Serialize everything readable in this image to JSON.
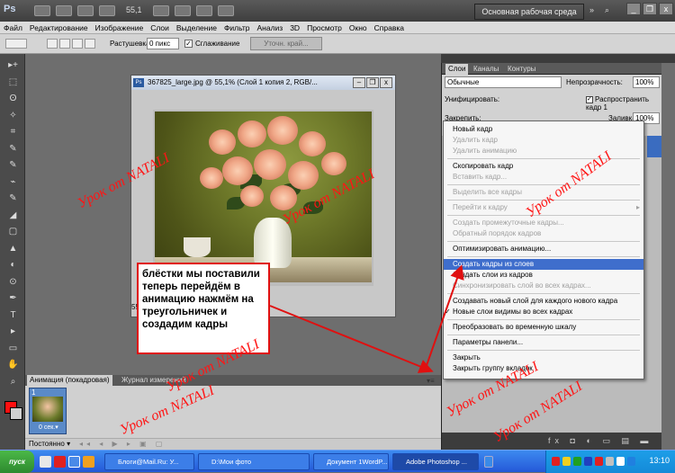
{
  "app": {
    "logo": "Ps",
    "zoom": "55,1",
    "workspace": "Основная рабочая среда",
    "workspace_arrow": "»",
    "search": "⌕",
    "minimize": "_",
    "restore": "❐",
    "close": "x"
  },
  "menubar": [
    "Файл",
    "Редактирование",
    "Изображение",
    "Слои",
    "Выделение",
    "Фильтр",
    "Анализ",
    "3D",
    "Просмотр",
    "Окно",
    "Справка"
  ],
  "options": {
    "feather_label": "Растушевка:",
    "feather_value": "0 пикс",
    "antialias_label": "Сглаживание",
    "antialias_checked": "✓",
    "refine_button": "Уточн. край..."
  },
  "document": {
    "title": "367825_large.jpg @ 55,1% (Слой 1 копия 2, RGB/...",
    "icon": "Ps",
    "minimize": "‒",
    "restore": "❐",
    "close": "x",
    "zoom_status": "55"
  },
  "note": "блёстки мы поставили теперь перейдём в анимацию нажмём на треугольничек и создадим кадры",
  "layers_panel": {
    "tabs": [
      "Слои",
      "Каналы",
      "Контуры"
    ],
    "blend_mode": "Обычные",
    "opacity_label": "Непрозрачность:",
    "opacity": "100%",
    "unify_label": "Унифицировать:",
    "propagate_label": "Распространить кадр 1",
    "propagate_checked": "✓",
    "lock_label": "Закрепить:",
    "fill_label": "Заливка:",
    "fill": "100%",
    "bottom_icons": "fx ◘ ◐ ▭ ▤ ▬"
  },
  "context_menu": {
    "items": [
      {
        "label": "Новый кадр",
        "state": "normal"
      },
      {
        "label": "Удалить кадр",
        "state": "disabled"
      },
      {
        "label": "Удалить анимацию",
        "state": "disabled"
      },
      {
        "sep": true
      },
      {
        "label": "Скопировать кадр",
        "state": "normal"
      },
      {
        "label": "Вставить кадр...",
        "state": "disabled"
      },
      {
        "sep": true
      },
      {
        "label": "Выделить все кадры",
        "state": "disabled"
      },
      {
        "sep": true
      },
      {
        "label": "Перейти к кадру",
        "state": "disabled",
        "submenu": true
      },
      {
        "sep": true
      },
      {
        "label": "Создать промежуточные кадры...",
        "state": "disabled"
      },
      {
        "label": "Обратный порядок кадров",
        "state": "disabled"
      },
      {
        "sep": true
      },
      {
        "label": "Оптимизировать анимацию...",
        "state": "normal"
      },
      {
        "sep": true
      },
      {
        "label": "Создать кадры из слоев",
        "state": "highlight"
      },
      {
        "label": "Создать слои из кадров",
        "state": "normal"
      },
      {
        "label": "Синхронизировать слой во всех кадрах...",
        "state": "disabled"
      },
      {
        "sep": true
      },
      {
        "label": "Создавать новый слой для каждого нового кадра",
        "state": "normal"
      },
      {
        "label": "Новые слои видимы во всех кадрах",
        "state": "normal",
        "checked": true
      },
      {
        "sep": true
      },
      {
        "label": "Преобразовать во временную шкалу",
        "state": "normal"
      },
      {
        "sep": true
      },
      {
        "label": "Параметры панели...",
        "state": "normal"
      },
      {
        "sep": true
      },
      {
        "label": "Закрыть",
        "state": "normal"
      },
      {
        "label": "Закрыть группу вкладок",
        "state": "normal"
      }
    ],
    "check_glyph": "✓",
    "submenu_glyph": "▸"
  },
  "animation_panel": {
    "tabs": [
      "Анимация (покадровая)",
      "Журнал измерений"
    ],
    "frame_number": "1",
    "frame_delay": "0 сек.▾",
    "loop": "Постоянно ▾",
    "buttons": "◂◂ ◂ ▶ ▸ ▣ ▢",
    "menu": "▾≡"
  },
  "watermarks": [
    "Урок от NATALI",
    "Урок от NATALI",
    "Урок от NATALI",
    "Урок от NATALI",
    "Урок от NATALI",
    "Урок от NATALI",
    "Урок от NATALI"
  ],
  "taskbar": {
    "start": "пуск",
    "items": [
      "Блоги@Mail.Ru: У...",
      "D:\\Мои фото",
      "Документ 1WordP...",
      "Adobe Photoshop ..."
    ],
    "clock": "13:10"
  },
  "tools": [
    "▸+",
    "⬚",
    "ʘ",
    "✧",
    "⌗",
    "✎",
    "✎",
    "⌁",
    "✎",
    "◢",
    "▢",
    "▲",
    "◐",
    "⊙",
    "✒",
    "T",
    "▸",
    "▭",
    "✋",
    "⌕"
  ]
}
